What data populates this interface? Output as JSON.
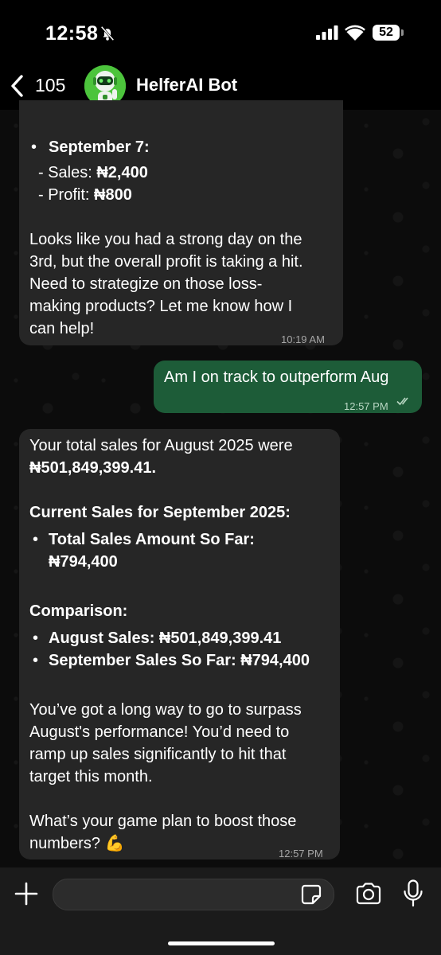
{
  "status_bar": {
    "time": "12:58",
    "battery": "52",
    "icons": [
      "bell-slash-icon",
      "signal-icon",
      "wifi-icon",
      "battery-icon"
    ]
  },
  "header": {
    "back_count": "105",
    "contact_name": "HelferAI Bot",
    "icons": [
      "chevron-left-icon",
      "robot-avatar"
    ]
  },
  "messages": {
    "first": {
      "bullet_title": "September 7:",
      "sales_label": "- Sales: ",
      "sales_value": "₦2,400",
      "profit_label": "- Profit: ",
      "profit_value": "₦800",
      "para_lines": [
        "Looks like you had a strong day on the",
        "3rd, but the overall profit is taking a hit.",
        "Need to strategize on those loss-",
        "making products? Let me know how I",
        "can help!"
      ],
      "time": "10:19 AM"
    },
    "outgoing": {
      "text": "Am I on track to outperform Aug",
      "time": "12:57 PM"
    },
    "reply": {
      "line1": "Your total sales for August 2025 were",
      "line2": "₦501,849,399.41.",
      "heading1": "Current Sales for September 2025:",
      "bullet1_line1": "Total Sales Amount So Far:",
      "bullet1_line2": "₦794,400",
      "heading2": "Comparison:",
      "bullet2": "August Sales: ₦501,849,399.41",
      "bullet3": "September Sales So Far: ₦794,400",
      "para1_lines": [
        "You’ve got a long way to go to surpass",
        "August's performance! You’d need to",
        "ramp up sales significantly to hit that",
        "target this month."
      ],
      "para2_line1": "What’s your game plan to boost those",
      "para2_line2": "numbers? 💪",
      "time": "12:57 PM"
    }
  },
  "composer": {
    "input_value": "",
    "icons": [
      "plus-icon",
      "sticker-icon",
      "camera-icon",
      "microphone-icon"
    ]
  },
  "colors": {
    "incoming_bubble": "#262626",
    "outgoing_bubble": "#1d5c38",
    "accent_green": "#3fbf3a"
  }
}
